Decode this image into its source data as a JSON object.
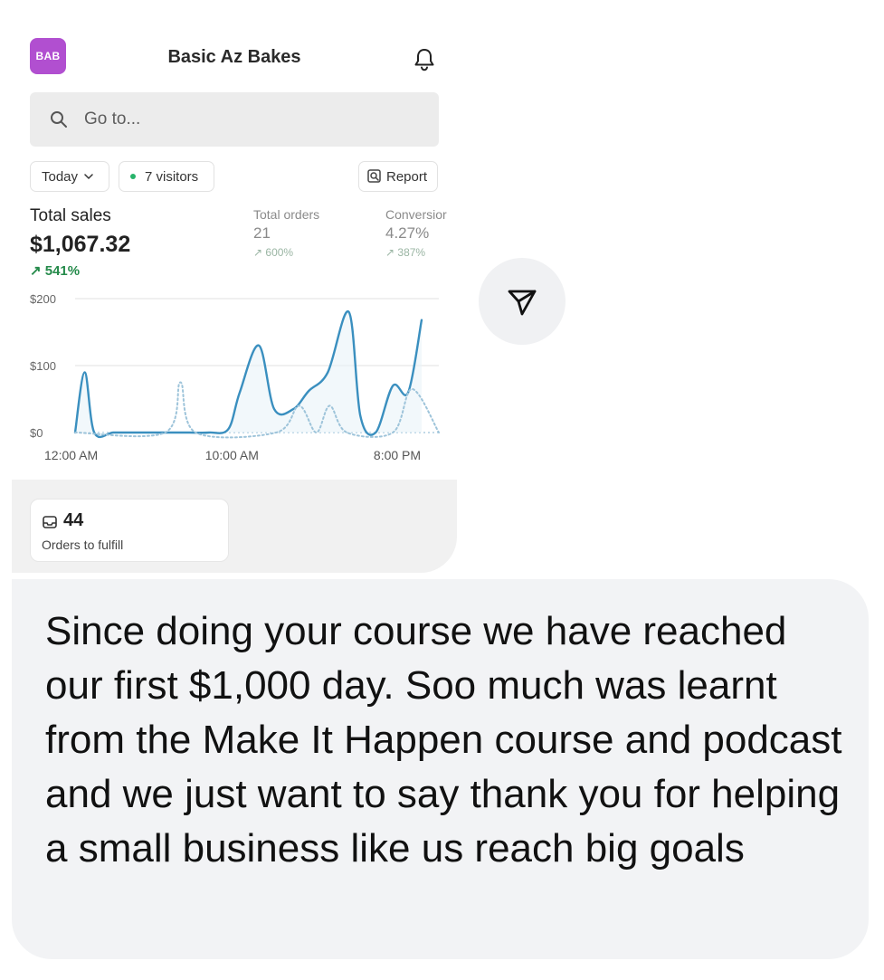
{
  "screenshot": {
    "app_badge": "BAB",
    "store_name": "Basic Az Bakes",
    "search": {
      "placeholder": "Go to..."
    },
    "filters": {
      "date_range": "Today",
      "visitors": "7 visitors",
      "report_label": "Report"
    },
    "metrics": {
      "total_sales": {
        "label": "Total sales",
        "value": "$1,067.32",
        "delta": "541%"
      },
      "total_orders": {
        "label": "Total orders",
        "value": "21",
        "delta": "600%"
      },
      "conversion": {
        "label": "Conversior",
        "value": "4.27%",
        "delta": "387%"
      }
    },
    "chart_data": {
      "type": "line",
      "title": "",
      "xlabel": "",
      "ylabel": "",
      "y_tick_labels": [
        "$200",
        "$100",
        "$0"
      ],
      "x_tick_labels": [
        "12:00 AM",
        "10:00 AM",
        "8:00 PM"
      ],
      "ylim": [
        0,
        200
      ],
      "grid": true,
      "series": [
        {
          "style": "solid",
          "color": "#3a8fbf",
          "points": [
            [
              0,
              0
            ],
            [
              0.5,
              90
            ],
            [
              1,
              0
            ],
            [
              2,
              0
            ],
            [
              3,
              0
            ],
            [
              4,
              0
            ],
            [
              5,
              0
            ],
            [
              6,
              0
            ],
            [
              7,
              0
            ],
            [
              8,
              5
            ],
            [
              8.6,
              60
            ],
            [
              9.6,
              130
            ],
            [
              10.4,
              35
            ],
            [
              11.4,
              35
            ],
            [
              12.2,
              62
            ],
            [
              13.2,
              90
            ],
            [
              14.3,
              180
            ],
            [
              14.9,
              25
            ],
            [
              15.7,
              0
            ],
            [
              16.6,
              70
            ],
            [
              17.4,
              60
            ],
            [
              18.1,
              168
            ]
          ]
        },
        {
          "style": "dotted",
          "color": "#9ec4da",
          "points": [
            [
              0,
              0
            ],
            [
              4.7,
              0
            ],
            [
              5.5,
              75
            ],
            [
              6.3,
              0
            ],
            [
              10.5,
              0
            ],
            [
              11.7,
              40
            ],
            [
              12.6,
              0
            ],
            [
              13.3,
              40
            ],
            [
              14.2,
              0
            ],
            [
              16.6,
              0
            ],
            [
              17.6,
              65
            ],
            [
              19,
              0
            ]
          ]
        }
      ]
    },
    "fulfillment": {
      "count": "44",
      "label": "Orders to fulfill"
    }
  },
  "message": {
    "text": "Since doing your course we have reached our first $1,000 day. Soo much was learnt from the Make It Happen course and podcast and we just want to say thank you for helping a small business like us reach big goals"
  },
  "colors": {
    "badge": "#b14fd0",
    "positive": "#248a4a",
    "chart_line": "#3a8fbf",
    "bubble_bg": "#f2f3f5"
  },
  "icons": [
    "bell-icon",
    "search-icon",
    "chevron-down-icon",
    "report-icon",
    "inbox-icon",
    "share-icon"
  ]
}
